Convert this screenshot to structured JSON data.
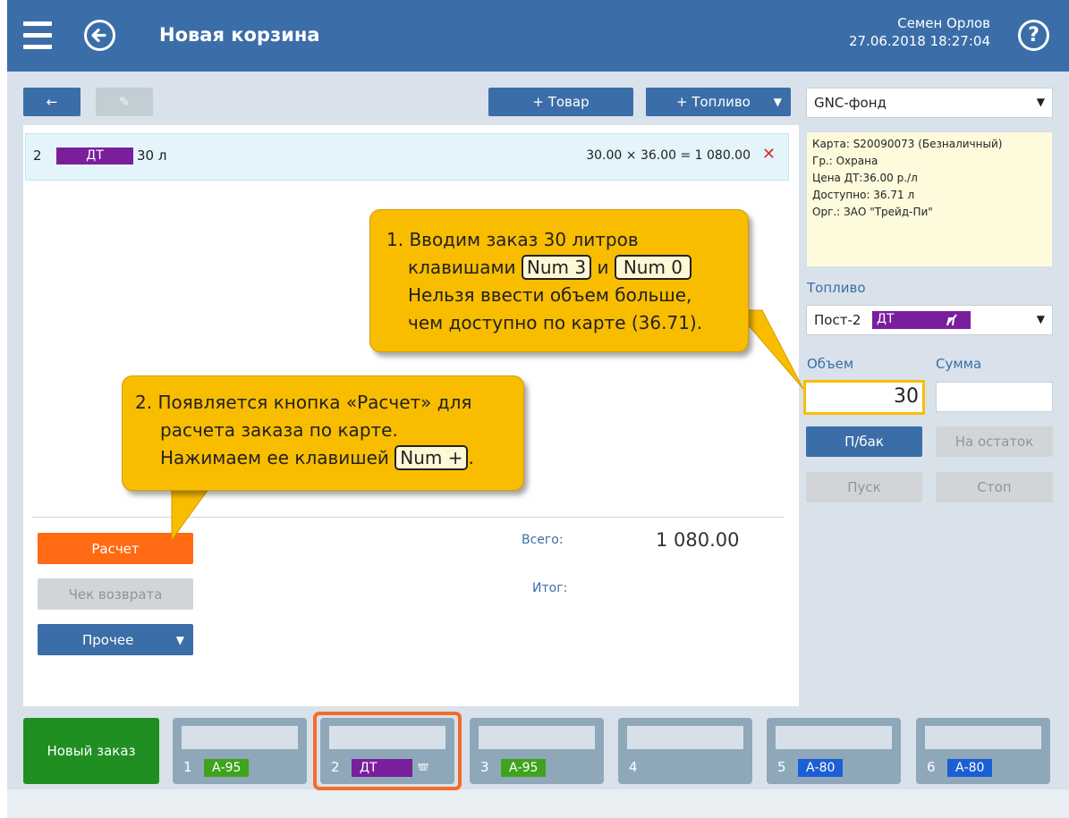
{
  "header": {
    "title": "Новая корзина",
    "user_name": "Семен Орлов",
    "datetime": "27.06.2018 18:27:04",
    "help_glyph": "?"
  },
  "toolbar": {
    "back_glyph": "←",
    "edit_glyph": "✎",
    "add_product_label": "+ Товар",
    "add_fuel_label": "+ Топливо",
    "dropdown_glyph": "▼"
  },
  "order_line": {
    "num": "2",
    "fuel": "ДТ",
    "volume": "30 л",
    "calc": "30.00 × 36.00 = 1 080.00",
    "remove_glyph": "✕"
  },
  "totals": {
    "total_label": "Всего:",
    "total_value": "1 080.00",
    "result_label": "Итог:"
  },
  "actions": {
    "calculate_label": "Расчет",
    "return_receipt_label": "Чек возврата",
    "other_label": "Прочее"
  },
  "right_panel": {
    "fund_value": "GNC-фонд",
    "card_info": [
      "Карта: S20090073 (Безналичный)",
      "Гр.: Охрана",
      "Цена ДТ:36.00 р./л",
      "Доступно: 36.71 л",
      "Орг.: ЗАО \"Трейд-Пи\""
    ],
    "fuel_label": "Топливо",
    "post_value": "Пост-2",
    "post_fuel": "ДТ",
    "volume_label": "Объем",
    "sum_label": "Сумма",
    "volume_value": "30",
    "sum_value": "",
    "full_tank_label": "П/бак",
    "remainder_label": "На остаток",
    "start_label": "Пуск",
    "stop_label": "Стоп"
  },
  "callout1": {
    "line1": "1. Вводим заказ 30 литров",
    "line2_pre": "клавишами",
    "key1": "Num 3",
    "line2_mid": "и",
    "key2": "Num 0",
    "line3": "Нельзя ввести объем больше,",
    "line4": "чем доступно по карте (36.71)."
  },
  "callout2": {
    "line1": "2. Появляется кнопка «Расчет» для",
    "line2": "расчета заказа по карте.",
    "line3_pre": "Нажимаем ее клавишей",
    "key": "Num +",
    "line3_post": "."
  },
  "bottom": {
    "new_order_label": "Новый заказ",
    "tabs": [
      {
        "num": "1",
        "fuel": "А-95",
        "color": "#3fa31d"
      },
      {
        "num": "2",
        "fuel": "ДТ",
        "color": "#7a1f9c"
      },
      {
        "num": "3",
        "fuel": "А-95",
        "color": "#3fa31d"
      },
      {
        "num": "4",
        "fuel": "",
        "color": ""
      },
      {
        "num": "5",
        "fuel": "А-80",
        "color": "#1b5fd6"
      },
      {
        "num": "6",
        "fuel": "А-80",
        "color": "#1b5fd6"
      }
    ]
  },
  "colors": {
    "header": "#3b6ea8",
    "calculate_button": "#ff6a13",
    "new_order": "#1f8f22",
    "callout": "#f9bd00",
    "active_tab_border": "#f46c2a"
  }
}
